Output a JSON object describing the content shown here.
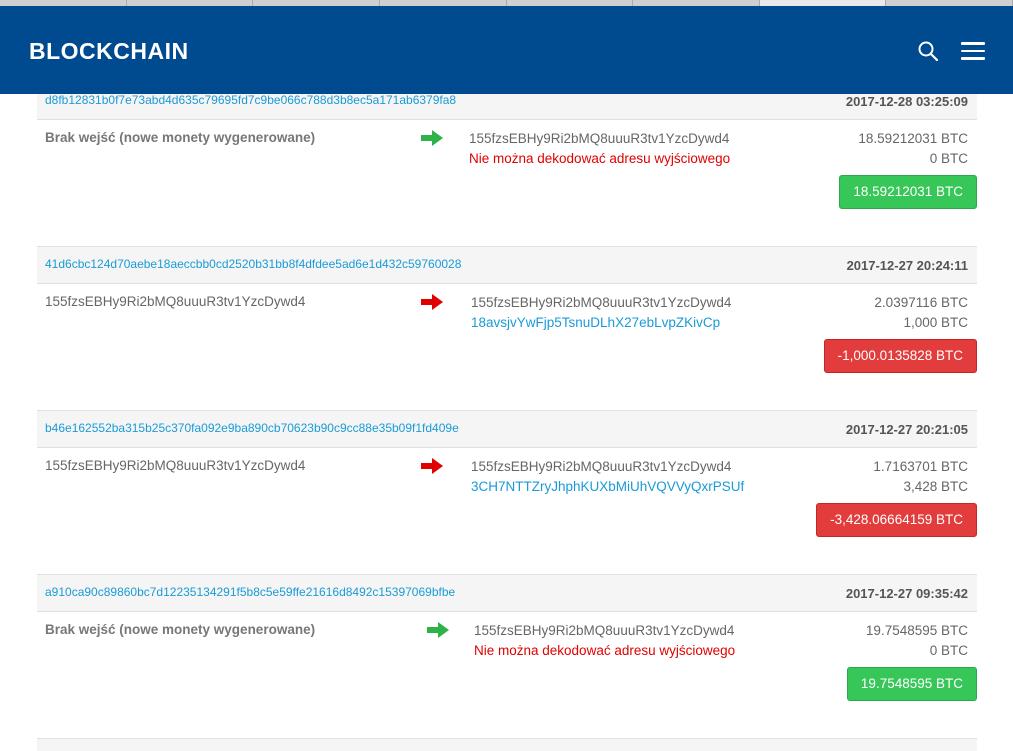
{
  "header": {
    "brand": "BLOCKCHAIN",
    "search_icon": "search-icon",
    "menu_icon": "hamburger-menu-icon",
    "bg_color": "#004a8f"
  },
  "colors": {
    "link": "#1a9bd7",
    "error": "#e00000",
    "positive": "#37c759",
    "negative": "#e23c3c",
    "arrow_in": "#2fb24a",
    "arrow_out": "#e00000"
  },
  "transactions": [
    {
      "hash": "d8fb12831b0f7e73abd4d635c79695fd7c9be066c788d3b8ec5a171ab6379fa8",
      "time": "2017-12-28 03:25:09",
      "from": "Brak wejść (nowe monety wygenerowane)",
      "direction": "in",
      "outputs": [
        "155fzsEBHy9Ri2bMQ8uuuR3tv1YzcDywd4",
        "Nie można dekodować adresu wyjściowego"
      ],
      "amounts": [
        "18.59212031 BTC",
        "0 BTC"
      ],
      "total": "18.59212031 BTC"
    },
    {
      "hash": "41d6cbc124d70aebe18aeccbb0cd2520b31bb8f4dfdee5ad6e1d432c59760028",
      "time": "2017-12-27 20:24:11",
      "from": "155fzsEBHy9Ri2bMQ8uuuR3tv1YzcDywd4",
      "direction": "out",
      "outputs": [
        "155fzsEBHy9Ri2bMQ8uuuR3tv1YzcDywd4",
        "18avsjvYwFjp5TsnuDLhX27ebLvpZKivCp"
      ],
      "amounts": [
        "2.0397116 BTC",
        "1,000 BTC"
      ],
      "total": "-1,000.0135828 BTC"
    },
    {
      "hash": "b46e162552ba315b25c370fa092e9ba890cb70623b90c9cc88e35b09f1fd409e",
      "time": "2017-12-27 20:21:05",
      "from": "155fzsEBHy9Ri2bMQ8uuuR3tv1YzcDywd4",
      "direction": "out",
      "outputs": [
        "155fzsEBHy9Ri2bMQ8uuuR3tv1YzcDywd4",
        "3CH7NTTZryJhphKUXbMiUhVQVVyQxrPSUf"
      ],
      "amounts": [
        "1.7163701 BTC",
        "3,428 BTC"
      ],
      "total": "-3,428.06664159 BTC"
    },
    {
      "hash": "a910ca90c89860bc7d12235134291f5b8c5e59ffe21616d8492c15397069bfbe",
      "time": "2017-12-27 09:35:42",
      "from": "Brak wejść (nowe monety wygenerowane)",
      "direction": "in",
      "outputs": [
        "155fzsEBHy9Ri2bMQ8uuuR3tv1YzcDywd4",
        "Nie można dekodować adresu wyjściowego"
      ],
      "amounts": [
        "19.7548595 BTC",
        "0 BTC"
      ],
      "total": "19.7548595 BTC"
    }
  ]
}
